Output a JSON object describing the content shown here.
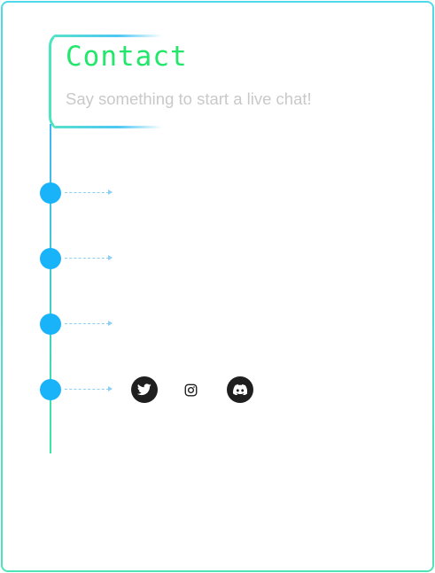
{
  "contact": {
    "title": "Contact",
    "subtitle": "Say something to start a live chat!"
  },
  "info_rows": [
    {
      "icon": "dot-marker",
      "text": ""
    },
    {
      "icon": "dot-marker",
      "text": ""
    },
    {
      "icon": "dot-marker",
      "text": ""
    },
    {
      "icon": "dot-marker",
      "text": ""
    }
  ],
  "socials": [
    {
      "name": "twitter",
      "icon": "twitter-icon"
    },
    {
      "name": "instagram",
      "icon": "instagram-icon"
    },
    {
      "name": "discord",
      "icon": "discord-icon"
    }
  ],
  "colors": {
    "accent_green": "#23e66c",
    "accent_blue": "#19b3fa",
    "subtitle_gray": "#c9c9c9",
    "border_gradient_top": "#4fd9ea",
    "border_gradient_bottom": "#4fe3b8",
    "social_dark": "#1f1f1f"
  }
}
